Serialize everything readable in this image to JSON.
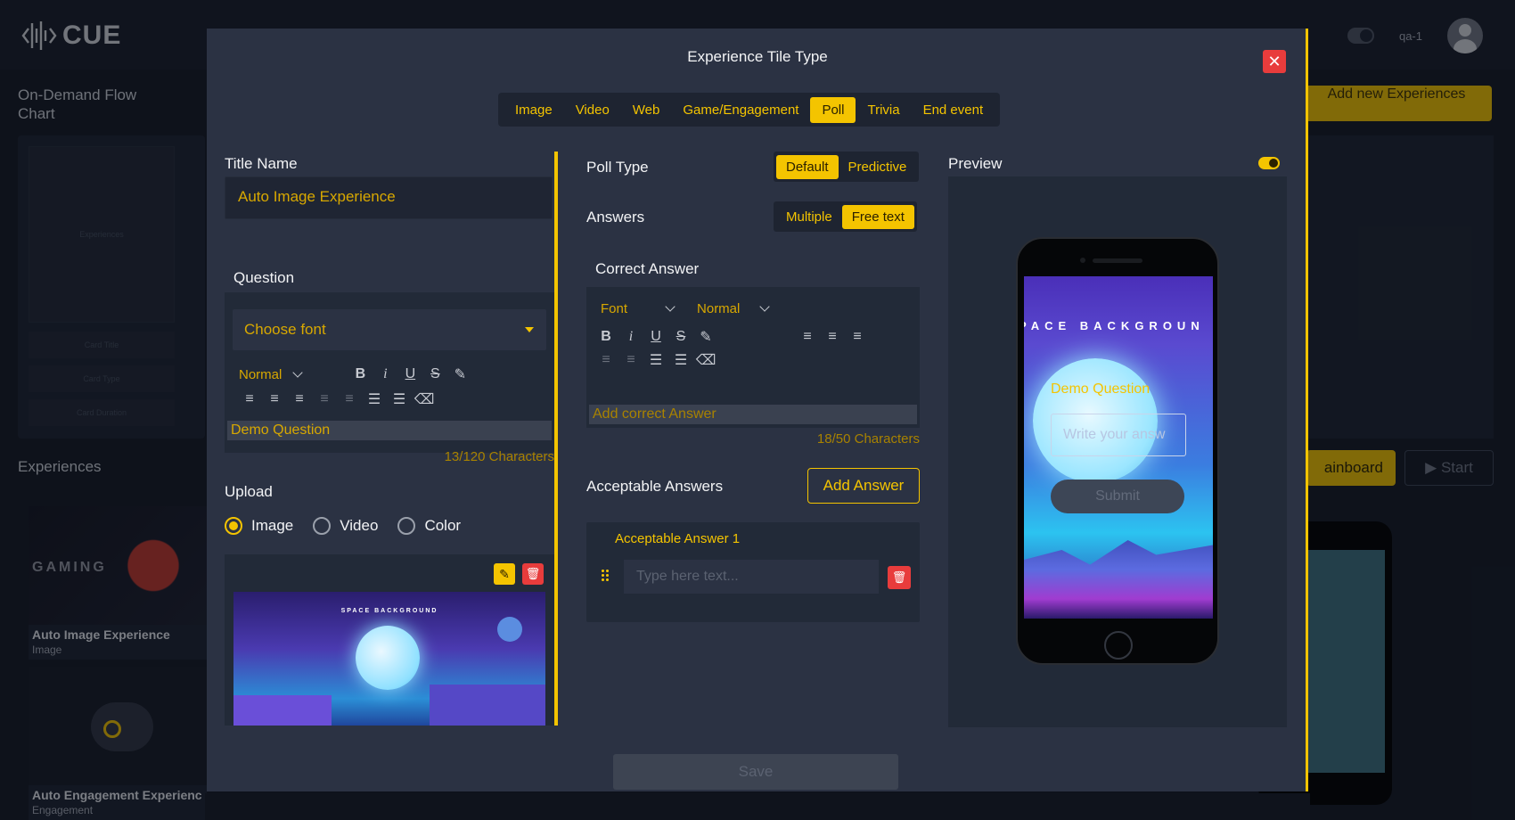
{
  "app": {
    "logo_text": "CUE",
    "user_name": "qa-1",
    "page_title": "On-Demand Flow Chart",
    "experiences_heading": "Experiences",
    "add_new_label": "Add new Experiences",
    "rainboard_label": "ainboard",
    "start_label": "▶  Start",
    "flow_placeholders": [
      "Experiences",
      "Card Title",
      "Card Type",
      "Card Duration"
    ],
    "cards": [
      {
        "title": "Auto Image Experience",
        "type": "Image",
        "image_text": "GAMING"
      },
      {
        "title": "Auto Engagement Experienc",
        "type": "Engagement"
      }
    ]
  },
  "modal": {
    "title": "Experience Tile Type",
    "close_label": "✕",
    "tabs": [
      {
        "label": "Image",
        "active": false
      },
      {
        "label": "Video",
        "active": false
      },
      {
        "label": "Web",
        "active": false
      },
      {
        "label": "Game/Engagement",
        "active": false
      },
      {
        "label": "Poll",
        "active": true
      },
      {
        "label": "Trivia",
        "active": false
      },
      {
        "label": "End event",
        "active": false
      }
    ],
    "title_name_label": "Title Name",
    "title_name_value": "Auto Image Experience",
    "question_label": "Question",
    "question_editor": {
      "font_placeholder": "Choose font",
      "size_value": "Normal",
      "value": "Demo Question",
      "counter": "13/120 Characters"
    },
    "upload_label": "Upload",
    "upload_options": [
      {
        "label": "Image",
        "selected": true
      },
      {
        "label": "Video",
        "selected": false
      },
      {
        "label": "Color",
        "selected": false
      }
    ],
    "upload_image_caption": "SPACE BACKGROUND",
    "poll_type_label": "Poll Type",
    "poll_type_options": [
      {
        "label": "Default",
        "active": true
      },
      {
        "label": "Predictive",
        "active": false
      }
    ],
    "answers_label": "Answers",
    "answers_options": [
      {
        "label": "Multiple",
        "active": false
      },
      {
        "label": "Free text",
        "active": true
      }
    ],
    "correct_answer_label": "Correct Answer",
    "correct_answer_editor": {
      "font_value": "Font",
      "size_value": "Normal",
      "placeholder": "Add correct Answer",
      "counter": "18/50 Characters"
    },
    "acceptable_answers_label": "Acceptable Answers",
    "add_answer_label": "Add Answer",
    "acceptable_answers": [
      {
        "label": "Acceptable Answer 1",
        "placeholder": "Type here text..."
      }
    ],
    "preview_label": "Preview",
    "preview_toggle_on": true,
    "preview_phone": {
      "background_text": "PACE BACKGROUN",
      "question": "Demo Question",
      "input_placeholder": "Write your answ",
      "submit_label": "Submit"
    },
    "save_label": "Save"
  },
  "colors": {
    "accent": "#f4c400",
    "danger": "#e83c3c",
    "modal_bg": "#2b3243",
    "page_bg": "#131924"
  }
}
